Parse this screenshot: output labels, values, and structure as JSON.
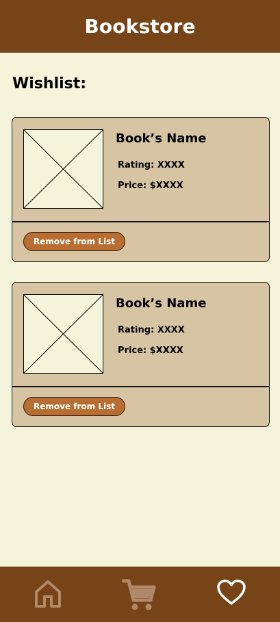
{
  "header": {
    "title": "Bookstore"
  },
  "wishlist": {
    "title": "Wishlist:",
    "items": [
      {
        "name": "Book’s Name",
        "rating": "Rating: XXXX",
        "price": "Price: $XXXX",
        "remove_label": "Remove from List"
      },
      {
        "name": "Book’s Name",
        "rating": "Rating: XXXX",
        "price": "Price: $XXXX",
        "remove_label": "Remove from List"
      }
    ]
  },
  "nav": {
    "items": [
      {
        "icon": "home-icon",
        "color": "#b0896b"
      },
      {
        "icon": "cart-icon",
        "color": "#b0896b"
      },
      {
        "icon": "heart-icon",
        "color": "#ffffff",
        "active": true
      }
    ]
  },
  "colors": {
    "brand": "#774418",
    "background": "#f4f4da",
    "card": "#d7c4a3",
    "button": "#b86e32"
  }
}
